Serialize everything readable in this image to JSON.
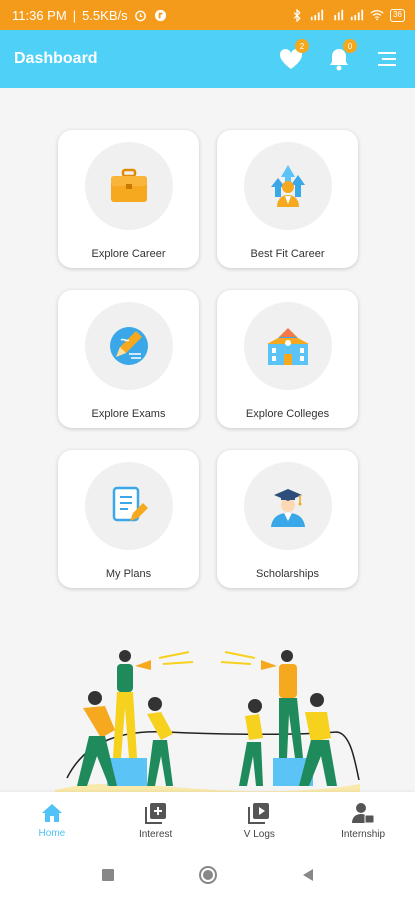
{
  "status": {
    "time": "11:36 PM",
    "speed": "5.5KB/s",
    "battery": "36"
  },
  "app_bar": {
    "title": "Dashboard",
    "favorites_count": "2",
    "notifications_count": "0",
    "colors": {
      "bar": "#4fd0f6",
      "status": "#f49b1c",
      "badge": "#f4a81d"
    }
  },
  "cards": [
    {
      "label": "Explore Career",
      "icon": "briefcase-icon"
    },
    {
      "label": "Best Fit Career",
      "icon": "career-growth-icon"
    },
    {
      "label": "Explore Exams",
      "icon": "exam-pen-icon"
    },
    {
      "label": "Explore Colleges",
      "icon": "college-building-icon"
    },
    {
      "label": "My Plans",
      "icon": "plan-document-icon"
    },
    {
      "label": "Scholarships",
      "icon": "graduate-icon"
    }
  ],
  "bottom_nav": [
    {
      "label": "Home",
      "icon": "home-icon",
      "active": true
    },
    {
      "label": "Interest",
      "icon": "add-box-icon",
      "active": false
    },
    {
      "label": "V Logs",
      "icon": "video-library-icon",
      "active": false
    },
    {
      "label": "Internship",
      "icon": "person-work-icon",
      "active": false
    }
  ]
}
